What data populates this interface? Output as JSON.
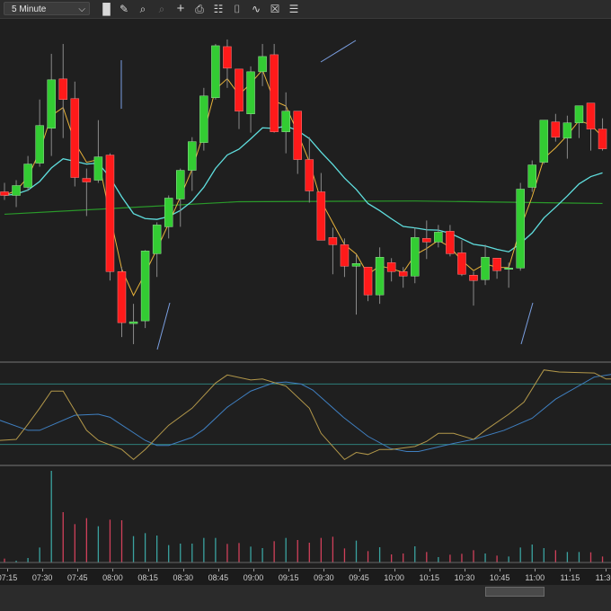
{
  "toolbar": {
    "interval": "5 Minute",
    "icons": [
      "bar-type",
      "draw-tools",
      "zoom-in",
      "zoom-out",
      "crosshair",
      "properties",
      "data-box",
      "chart-style",
      "indicators",
      "strategies",
      "templates"
    ]
  },
  "colors": {
    "up": "#33cc33",
    "down": "#ff1a1a",
    "fast_ma": "#e8b33a",
    "slow_ma": "#5fdede",
    "long_ma": "#2a9a2a",
    "osc_k": "#b3984a",
    "osc_d": "#3f7fc0",
    "vol_up": "#3aa3a0",
    "vol_down": "#d0405a",
    "level": "#2f7f7a"
  },
  "chart_data": {
    "type": "candlestick",
    "xlabel": "",
    "ylabel": "",
    "x_ticks": [
      "07:15",
      "07:30",
      "07:45",
      "08:00",
      "08:15",
      "08:30",
      "08:45",
      "09:00",
      "09:15",
      "09:30",
      "09:45",
      "10:00",
      "10:15",
      "10:30",
      "10:45",
      "11:00",
      "11:15",
      "11:30"
    ],
    "bar_interval_minutes": 5,
    "ylim": [
      0,
      95
    ],
    "candles": [
      [
        46.75,
        49.25,
        44.5,
        45.75
      ],
      [
        45.75,
        50,
        42.5,
        48.5
      ],
      [
        48,
        56.75,
        47,
        54.5
      ],
      [
        54.75,
        72.5,
        53.75,
        65.25
      ],
      [
        64.5,
        85.25,
        56.75,
        78
      ],
      [
        78.25,
        88,
        61.75,
        72.5
      ],
      [
        72.75,
        77.5,
        48.25,
        50.75
      ],
      [
        50.5,
        53.25,
        40,
        49.5
      ],
      [
        50,
        66.75,
        49.25,
        56.5
      ],
      [
        57,
        57.5,
        22,
        24.5
      ],
      [
        24.5,
        25.75,
        6.25,
        10.25
      ],
      [
        10,
        15.5,
        4.25,
        10.5
      ],
      [
        10.75,
        30.5,
        8.75,
        30.25
      ],
      [
        29.5,
        38.25,
        23,
        37.5
      ],
      [
        37,
        45.75,
        33.75,
        45
      ],
      [
        44.75,
        53.25,
        37,
        52.75
      ],
      [
        52.75,
        62,
        47,
        60.75
      ],
      [
        60.5,
        75.75,
        58.25,
        73.5
      ],
      [
        73,
        88,
        72.5,
        87.5
      ],
      [
        87.25,
        89.25,
        75.75,
        81.25
      ],
      [
        81,
        81,
        64.25,
        69.25
      ],
      [
        68.5,
        81.75,
        63.25,
        80.25
      ],
      [
        80.25,
        88,
        76.25,
        84.5
      ],
      [
        85,
        88,
        63.25,
        63.5
      ],
      [
        63.5,
        74.5,
        57.5,
        69.25
      ],
      [
        69.25,
        69.25,
        51.75,
        55.75
      ],
      [
        55.75,
        62,
        43.75,
        47
      ],
      [
        46.75,
        52,
        33.25,
        33.25
      ],
      [
        34,
        36.75,
        23.75,
        32
      ],
      [
        32,
        33.75,
        23,
        26
      ],
      [
        26,
        29.25,
        12.5,
        26.75
      ],
      [
        25.75,
        25.75,
        16.25,
        18
      ],
      [
        18,
        31.25,
        15.5,
        28.5
      ],
      [
        27,
        28.25,
        21.75,
        24.5
      ],
      [
        24.5,
        25.75,
        20,
        23.25
      ],
      [
        23.25,
        36.75,
        21.25,
        34
      ],
      [
        33.75,
        38.75,
        28,
        32.75
      ],
      [
        32.75,
        37.5,
        31.25,
        35.5
      ],
      [
        35.75,
        37.5,
        28.75,
        29.5
      ],
      [
        29.75,
        33.25,
        23.25,
        23.75
      ],
      [
        23.5,
        24.5,
        15,
        22
      ],
      [
        22.25,
        32,
        20.75,
        28.5
      ],
      [
        28.25,
        28.25,
        22.5,
        24.75
      ],
      [
        25.25,
        27,
        20,
        25.5
      ],
      [
        25.5,
        49.25,
        24.75,
        47.5
      ],
      [
        48,
        55.5,
        46.75,
        54.25
      ],
      [
        55,
        66.75,
        54.5,
        66.75
      ],
      [
        66.25,
        68.5,
        60.75,
        62
      ],
      [
        61.75,
        68,
        56,
        66
      ],
      [
        66,
        70.75,
        61.75,
        70.75
      ],
      [
        71.5,
        71.5,
        58.25,
        64.25
      ],
      [
        64.25,
        67.25,
        58.25,
        58.75
      ]
    ],
    "long_ma": [
      [
        0,
        40.5
      ],
      [
        20,
        44
      ],
      [
        35,
        44.2
      ],
      [
        51,
        43.5
      ]
    ],
    "oscillator": {
      "ylim": [
        0,
        100
      ],
      "levels": [
        80,
        20
      ],
      "k": [
        [
          -0.4,
          24
        ],
        [
          1,
          25
        ],
        [
          2,
          40
        ],
        [
          3,
          56
        ],
        [
          4,
          73
        ],
        [
          5,
          73
        ],
        [
          7,
          34
        ],
        [
          8,
          24
        ],
        [
          10,
          15
        ],
        [
          11,
          5
        ],
        [
          12,
          15
        ],
        [
          14,
          39
        ],
        [
          16,
          56
        ],
        [
          18,
          81
        ],
        [
          19,
          89
        ],
        [
          21,
          84
        ],
        [
          22,
          85
        ],
        [
          24,
          78
        ],
        [
          26,
          56
        ],
        [
          27,
          31
        ],
        [
          29,
          5
        ],
        [
          30,
          12
        ],
        [
          31,
          10
        ],
        [
          32,
          15
        ],
        [
          33,
          15
        ],
        [
          35,
          18
        ],
        [
          36,
          23
        ],
        [
          37,
          31
        ],
        [
          38.3,
          31
        ],
        [
          40,
          25
        ],
        [
          41,
          34
        ],
        [
          43,
          50
        ],
        [
          44.3,
          62
        ],
        [
          46,
          94
        ],
        [
          47.3,
          92
        ],
        [
          50.3,
          91
        ],
        [
          51.3,
          85
        ],
        [
          52,
          85
        ]
      ],
      "d": [
        [
          -0.4,
          44
        ],
        [
          2,
          34
        ],
        [
          3,
          34
        ],
        [
          6,
          49
        ],
        [
          8,
          50
        ],
        [
          9,
          47
        ],
        [
          12,
          24
        ],
        [
          13,
          19
        ],
        [
          14,
          19
        ],
        [
          16,
          27
        ],
        [
          17,
          35
        ],
        [
          19,
          57
        ],
        [
          21,
          73
        ],
        [
          22.9,
          81
        ],
        [
          24,
          82
        ],
        [
          25.3,
          80
        ],
        [
          26.3,
          74
        ],
        [
          28.9,
          47
        ],
        [
          31,
          28
        ],
        [
          32.9,
          16
        ],
        [
          34.3,
          13
        ],
        [
          35.3,
          13
        ],
        [
          38.3,
          21
        ],
        [
          40,
          25
        ],
        [
          42.6,
          34
        ],
        [
          45,
          46
        ],
        [
          47,
          65
        ],
        [
          50.3,
          87
        ],
        [
          52,
          90
        ]
      ]
    },
    "volume": [
      130,
      60,
      150,
      500,
      3060,
      1680,
      1280,
      1480,
      1210,
      1430,
      1410,
      880,
      980,
      900,
      580,
      630,
      630,
      820,
      820,
      620,
      650,
      530,
      480,
      710,
      820,
      750,
      660,
      820,
      860,
      470,
      730,
      380,
      510,
      270,
      300,
      540,
      350,
      180,
      260,
      290,
      410,
      300,
      230,
      200,
      500,
      600,
      480,
      410,
      350,
      350,
      340,
      200
    ]
  }
}
